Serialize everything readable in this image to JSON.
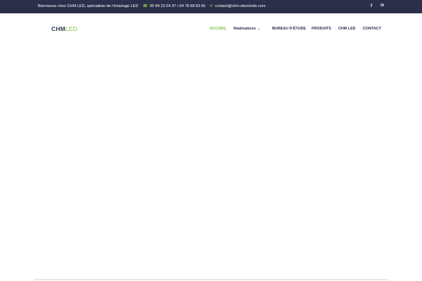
{
  "topbar": {
    "welcome": "Bienvenue chez CHM LED, spécialiste de l'éclairage LED",
    "phone_icon": "phone-icon",
    "phones": "06 84 23 04 37  /  04 78 68 83 65",
    "mail_icon": "envelope-icon",
    "email": "contact@chm-electricite.com",
    "social": {
      "facebook": "f",
      "linkedin": "in"
    }
  },
  "header": {
    "logo": {
      "part1": "CHM",
      "part2": "LED"
    },
    "nav": [
      {
        "label": "ACCUEIL",
        "active": true
      },
      {
        "label": "Réalisations",
        "has_dropdown": true
      },
      {
        "label": "BUREAU D'ÉTUDE"
      },
      {
        "label": "PRODUITS"
      },
      {
        "label": "CHM LED"
      },
      {
        "label": "CONTACT"
      }
    ]
  },
  "colors": {
    "topbar_bg": "#2b2f4a",
    "accent_green": "#7dc142",
    "nav_text": "#2b2f4a"
  }
}
